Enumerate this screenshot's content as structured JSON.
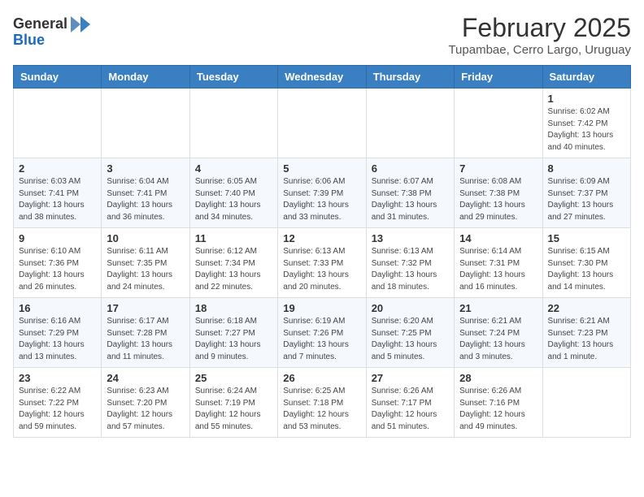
{
  "header": {
    "logo_general": "General",
    "logo_blue": "Blue",
    "month_title": "February 2025",
    "location": "Tupambae, Cerro Largo, Uruguay"
  },
  "weekdays": [
    "Sunday",
    "Monday",
    "Tuesday",
    "Wednesday",
    "Thursday",
    "Friday",
    "Saturday"
  ],
  "weeks": [
    [
      {
        "day": "",
        "info": ""
      },
      {
        "day": "",
        "info": ""
      },
      {
        "day": "",
        "info": ""
      },
      {
        "day": "",
        "info": ""
      },
      {
        "day": "",
        "info": ""
      },
      {
        "day": "",
        "info": ""
      },
      {
        "day": "1",
        "info": "Sunrise: 6:02 AM\nSunset: 7:42 PM\nDaylight: 13 hours\nand 40 minutes."
      }
    ],
    [
      {
        "day": "2",
        "info": "Sunrise: 6:03 AM\nSunset: 7:41 PM\nDaylight: 13 hours\nand 38 minutes."
      },
      {
        "day": "3",
        "info": "Sunrise: 6:04 AM\nSunset: 7:41 PM\nDaylight: 13 hours\nand 36 minutes."
      },
      {
        "day": "4",
        "info": "Sunrise: 6:05 AM\nSunset: 7:40 PM\nDaylight: 13 hours\nand 34 minutes."
      },
      {
        "day": "5",
        "info": "Sunrise: 6:06 AM\nSunset: 7:39 PM\nDaylight: 13 hours\nand 33 minutes."
      },
      {
        "day": "6",
        "info": "Sunrise: 6:07 AM\nSunset: 7:38 PM\nDaylight: 13 hours\nand 31 minutes."
      },
      {
        "day": "7",
        "info": "Sunrise: 6:08 AM\nSunset: 7:38 PM\nDaylight: 13 hours\nand 29 minutes."
      },
      {
        "day": "8",
        "info": "Sunrise: 6:09 AM\nSunset: 7:37 PM\nDaylight: 13 hours\nand 27 minutes."
      }
    ],
    [
      {
        "day": "9",
        "info": "Sunrise: 6:10 AM\nSunset: 7:36 PM\nDaylight: 13 hours\nand 26 minutes."
      },
      {
        "day": "10",
        "info": "Sunrise: 6:11 AM\nSunset: 7:35 PM\nDaylight: 13 hours\nand 24 minutes."
      },
      {
        "day": "11",
        "info": "Sunrise: 6:12 AM\nSunset: 7:34 PM\nDaylight: 13 hours\nand 22 minutes."
      },
      {
        "day": "12",
        "info": "Sunrise: 6:13 AM\nSunset: 7:33 PM\nDaylight: 13 hours\nand 20 minutes."
      },
      {
        "day": "13",
        "info": "Sunrise: 6:13 AM\nSunset: 7:32 PM\nDaylight: 13 hours\nand 18 minutes."
      },
      {
        "day": "14",
        "info": "Sunrise: 6:14 AM\nSunset: 7:31 PM\nDaylight: 13 hours\nand 16 minutes."
      },
      {
        "day": "15",
        "info": "Sunrise: 6:15 AM\nSunset: 7:30 PM\nDaylight: 13 hours\nand 14 minutes."
      }
    ],
    [
      {
        "day": "16",
        "info": "Sunrise: 6:16 AM\nSunset: 7:29 PM\nDaylight: 13 hours\nand 13 minutes."
      },
      {
        "day": "17",
        "info": "Sunrise: 6:17 AM\nSunset: 7:28 PM\nDaylight: 13 hours\nand 11 minutes."
      },
      {
        "day": "18",
        "info": "Sunrise: 6:18 AM\nSunset: 7:27 PM\nDaylight: 13 hours\nand 9 minutes."
      },
      {
        "day": "19",
        "info": "Sunrise: 6:19 AM\nSunset: 7:26 PM\nDaylight: 13 hours\nand 7 minutes."
      },
      {
        "day": "20",
        "info": "Sunrise: 6:20 AM\nSunset: 7:25 PM\nDaylight: 13 hours\nand 5 minutes."
      },
      {
        "day": "21",
        "info": "Sunrise: 6:21 AM\nSunset: 7:24 PM\nDaylight: 13 hours\nand 3 minutes."
      },
      {
        "day": "22",
        "info": "Sunrise: 6:21 AM\nSunset: 7:23 PM\nDaylight: 13 hours\nand 1 minute."
      }
    ],
    [
      {
        "day": "23",
        "info": "Sunrise: 6:22 AM\nSunset: 7:22 PM\nDaylight: 12 hours\nand 59 minutes."
      },
      {
        "day": "24",
        "info": "Sunrise: 6:23 AM\nSunset: 7:20 PM\nDaylight: 12 hours\nand 57 minutes."
      },
      {
        "day": "25",
        "info": "Sunrise: 6:24 AM\nSunset: 7:19 PM\nDaylight: 12 hours\nand 55 minutes."
      },
      {
        "day": "26",
        "info": "Sunrise: 6:25 AM\nSunset: 7:18 PM\nDaylight: 12 hours\nand 53 minutes."
      },
      {
        "day": "27",
        "info": "Sunrise: 6:26 AM\nSunset: 7:17 PM\nDaylight: 12 hours\nand 51 minutes."
      },
      {
        "day": "28",
        "info": "Sunrise: 6:26 AM\nSunset: 7:16 PM\nDaylight: 12 hours\nand 49 minutes."
      },
      {
        "day": "",
        "info": ""
      }
    ]
  ]
}
